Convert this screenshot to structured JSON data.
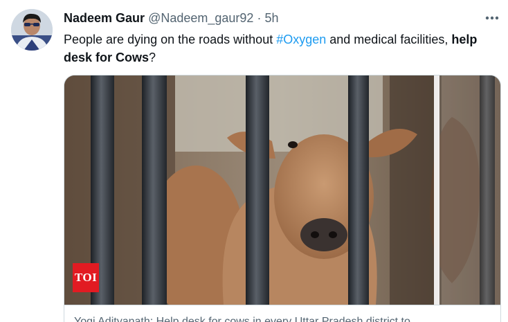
{
  "author": {
    "name": "Nadeem Gaur",
    "handle": "@Nadeem_gaur92",
    "separator": "·",
    "time": "5h"
  },
  "tweet": {
    "text_before": "People are dying on the roads without ",
    "hashtag": "#Oxygen",
    "text_middle": " and medical facilities, ",
    "text_bold": "help desk for Cows",
    "text_after": "?"
  },
  "card": {
    "badge": "TOI",
    "caption": "Yogi Adityanath: Help desk for cows in every Uttar Pradesh district to"
  },
  "icons": {
    "more": "more-horizontal-icon"
  },
  "colors": {
    "link": "#1d9bf0",
    "secondary_text": "#536471",
    "primary_text": "#0f1419",
    "badge": "#e21b22"
  }
}
